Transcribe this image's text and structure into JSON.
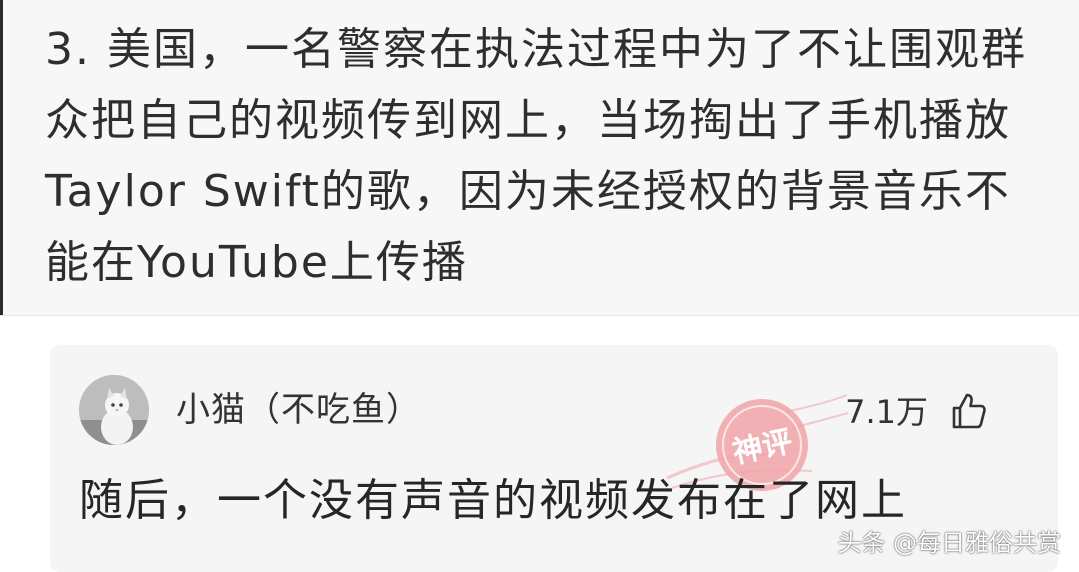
{
  "post": {
    "text": "3. 美国，一名警察在执法过程中为了不让围观群众把自己的视频传到网上，当场掏出了手机播放Taylor Swift的歌，因为未经授权的背景音乐不能在YouTube上传播"
  },
  "comment": {
    "username": "小猫（不吃鱼）",
    "like_count": "7.1万",
    "text": "随后，一个没有声音的视频发布在了网上",
    "stamp_text": "神评",
    "avatar_icon": "cat-avatar",
    "like_icon": "thumbs-up-icon"
  },
  "watermark": "头条 @每日雅俗共赏",
  "colors": {
    "post_bg": "#f7f7f7",
    "card_bg": "#f5f5f5",
    "stamp": "#f0a3a8"
  }
}
